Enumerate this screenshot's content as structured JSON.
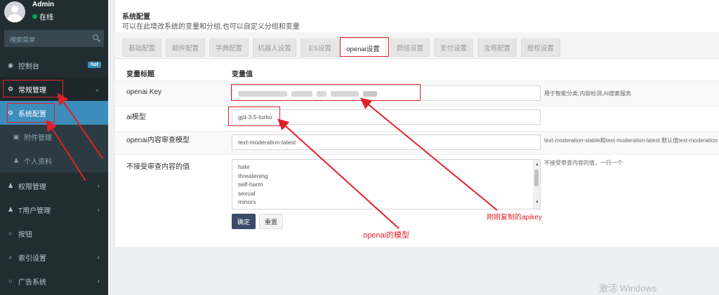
{
  "user": {
    "name": "Admin",
    "status": "在线"
  },
  "search": {
    "placeholder": "搜索菜单"
  },
  "sidebar": {
    "items": [
      {
        "label": "控制台",
        "icon": "dashboard-icon",
        "badge": "hot"
      },
      {
        "label": "常规管理",
        "icon": "cogs-icon"
      },
      {
        "label": "系统配置",
        "icon": "gear-icon"
      },
      {
        "label": "附件管理",
        "icon": "file-image-icon"
      },
      {
        "label": "个人资料",
        "icon": "user-icon"
      },
      {
        "label": "权限管理",
        "icon": "group-icon"
      },
      {
        "label": "T用户管理",
        "icon": "user-icon"
      },
      {
        "label": "按钮",
        "icon": "circle-icon"
      },
      {
        "label": "索引设置",
        "icon": "search-icon"
      },
      {
        "label": "广告系统",
        "icon": "circle-icon"
      }
    ]
  },
  "panel": {
    "title": "系统配置",
    "subtitle": "可以在此增改系统的变量和分组,也可以自定义分组和变量"
  },
  "tabs": [
    "基础配置",
    "邮件配置",
    "字典配置",
    "机器人设置",
    "ES设置",
    "openai设置",
    "群组设置",
    "支付设置",
    "宝塔配置",
    "授权设置"
  ],
  "table": {
    "header_title": "变量标题",
    "header_value": "变量值",
    "rows": [
      {
        "label": "openai Key",
        "value": "",
        "note": "用于智能分类,内容检测,AI搜索服务"
      },
      {
        "label": "ai模型",
        "value": "gpt-3.5-turbo",
        "note": ""
      },
      {
        "label": "openai内容审查模型",
        "value": "text-moderation-latest",
        "note": "text-moderation-stable和text-moderation-latest 默认值text-moderation"
      },
      {
        "label": "不接受审查内容的值",
        "values": [
          "hate",
          "threatening",
          "self-harm",
          "sexual",
          "minors"
        ],
        "note": "不接受审查内容的值，一行一个"
      }
    ]
  },
  "buttons": {
    "confirm": "确定",
    "reset": "重置"
  },
  "annotations": {
    "model": "openai的模型",
    "apikey": "刚刚复制的apikey"
  },
  "watermark": "激活 Windows",
  "colors": {
    "sidebar_bg": "#222d32",
    "active": "#3c8dbc",
    "annotation": "#e0202a"
  }
}
